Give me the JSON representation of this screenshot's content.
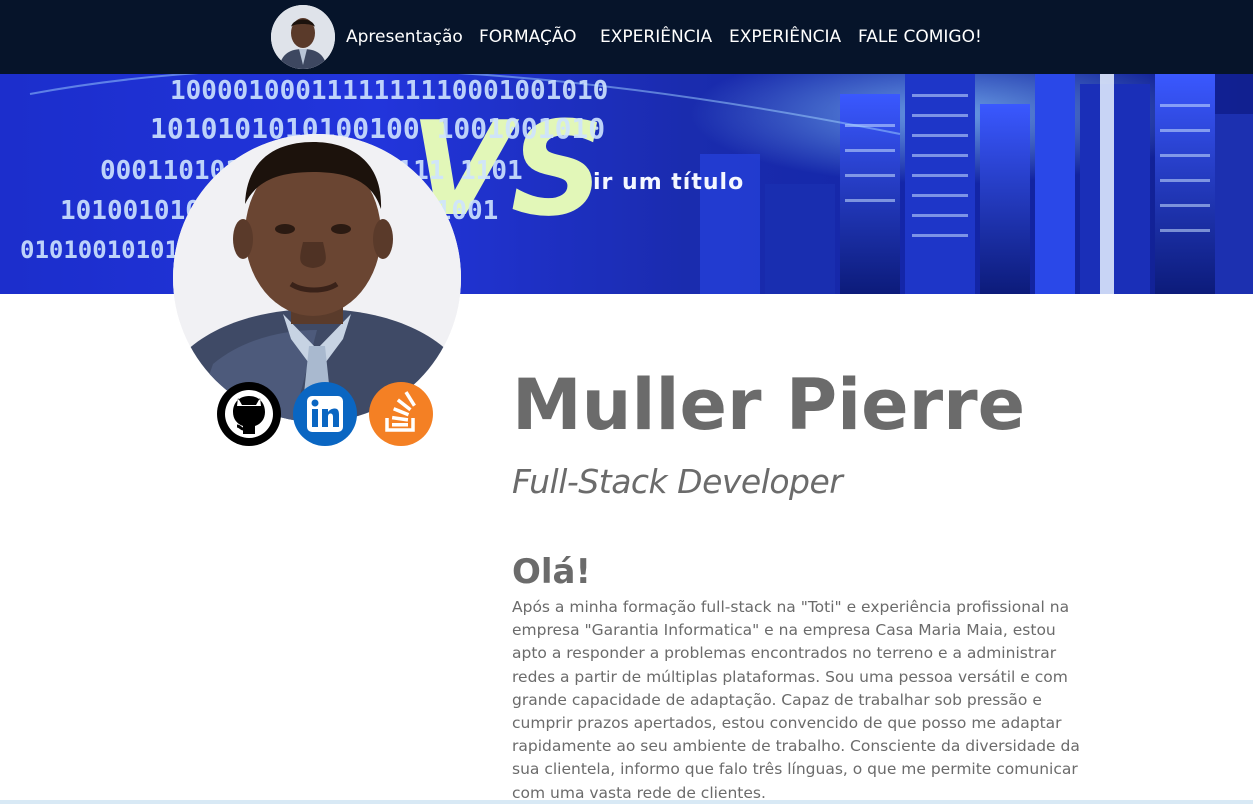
{
  "nav": {
    "avatar_alt": "Muller Pierre",
    "links": [
      {
        "label": "Apresentação"
      },
      {
        "label": "FORMAÇÃO"
      },
      {
        "label": "EXPERIÊNCIA"
      },
      {
        "label": "EXPERIÊNCIA"
      },
      {
        "label": "FALE COMIGO!"
      }
    ]
  },
  "banner": {
    "overlay_text": "ir um título",
    "logo_letters": "VS",
    "binary_rows": [
      "1000010001111111110001001010",
      "1010101010100100 1001001010",
      "0001101010010000 11111 1101",
      "1010010100101011110000101001",
      "0101001010111010101001010101"
    ],
    "colors": {
      "sky": "#2438e6",
      "logo": "#dff7b0"
    }
  },
  "profile": {
    "name": "Muller Pierre",
    "role": "Full-Stack Developer",
    "greeting": "Olá!",
    "about": "Após a minha formação full-stack na \"Toti\" e experiência profissional na empresa \"Garantia Informatica\" e na empresa Casa Maria Maia, estou apto a responder a problemas encontrados no terreno e a administrar redes a partir de múltiplas plataformas. Sou uma pessoa versátil e com grande capacidade de adaptação. Capaz de trabalhar sob pressão e cumprir prazos apertados, estou convencido de que posso me adaptar rapidamente ao seu ambiente de trabalho. Consciente da diversidade da sua clientela, informo que falo três línguas, o que me permite comunicar com uma vasta rede de clientes."
  },
  "social": [
    {
      "icon": "github-icon",
      "color": "#000000"
    },
    {
      "icon": "linkedin-icon",
      "color": "#0a66c2"
    },
    {
      "icon": "stackoverflow-icon",
      "color": "#f48024"
    }
  ],
  "colors": {
    "nav_bg": "#06142a",
    "text_gray": "#6b6b6b"
  }
}
